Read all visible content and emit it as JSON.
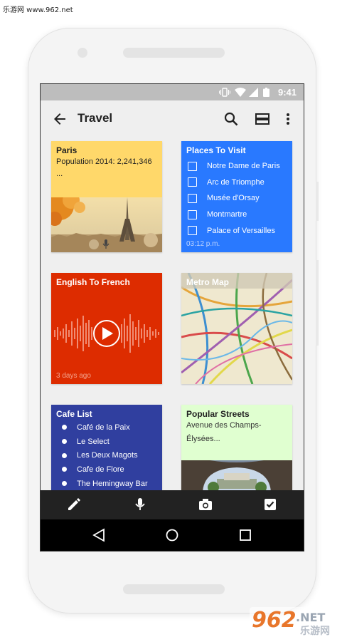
{
  "watermark": {
    "top_text": "乐游网 www.962.net",
    "brand_logo": "962.NET",
    "brand_sub": "乐游网"
  },
  "statusbar": {
    "time": "9:41",
    "icons": [
      "vibrate-icon",
      "wifi-icon",
      "signal-icon",
      "battery-icon"
    ]
  },
  "appbar": {
    "back_icon": "arrow-back-icon",
    "title": "Travel",
    "actions": [
      "search-icon",
      "view-toggle-icon",
      "more-vert-icon"
    ]
  },
  "cards": {
    "paris": {
      "title": "Paris",
      "text": "Population 2014: 2,241,346",
      "ellipsis": "...",
      "color": "#FFD86A",
      "icon": "mic-icon"
    },
    "places": {
      "title": "Places To Visit",
      "color": "#2979FF",
      "items": [
        "Notre Dame de Paris",
        "Arc de Triomphe",
        "Musée d'Orsay",
        "Montmartre",
        "Palace of Versailles"
      ],
      "timestamp": "03:12 p.m."
    },
    "english": {
      "title": "English To French",
      "footer": "3 days ago",
      "color": "#DD2C00",
      "icon": "play-icon"
    },
    "metro": {
      "title": "Metro Map"
    },
    "cafe": {
      "title": "Cafe List",
      "color": "#303F9F",
      "items": [
        "Café de la Paix",
        "Le Select",
        "Les Deux Magots",
        "Cafe de Flore",
        "The Hemingway Bar"
      ]
    },
    "streets": {
      "title": "Popular Streets",
      "text": "Avenue des Champs-Élysées...",
      "color": "#E0FFD0"
    }
  },
  "bottombar": {
    "icons": [
      "pencil-icon",
      "mic-icon",
      "camera-icon",
      "checkbox-icon"
    ]
  },
  "navbar": {
    "icons": [
      "back-triangle-icon",
      "home-circle-icon",
      "recents-square-icon"
    ]
  }
}
